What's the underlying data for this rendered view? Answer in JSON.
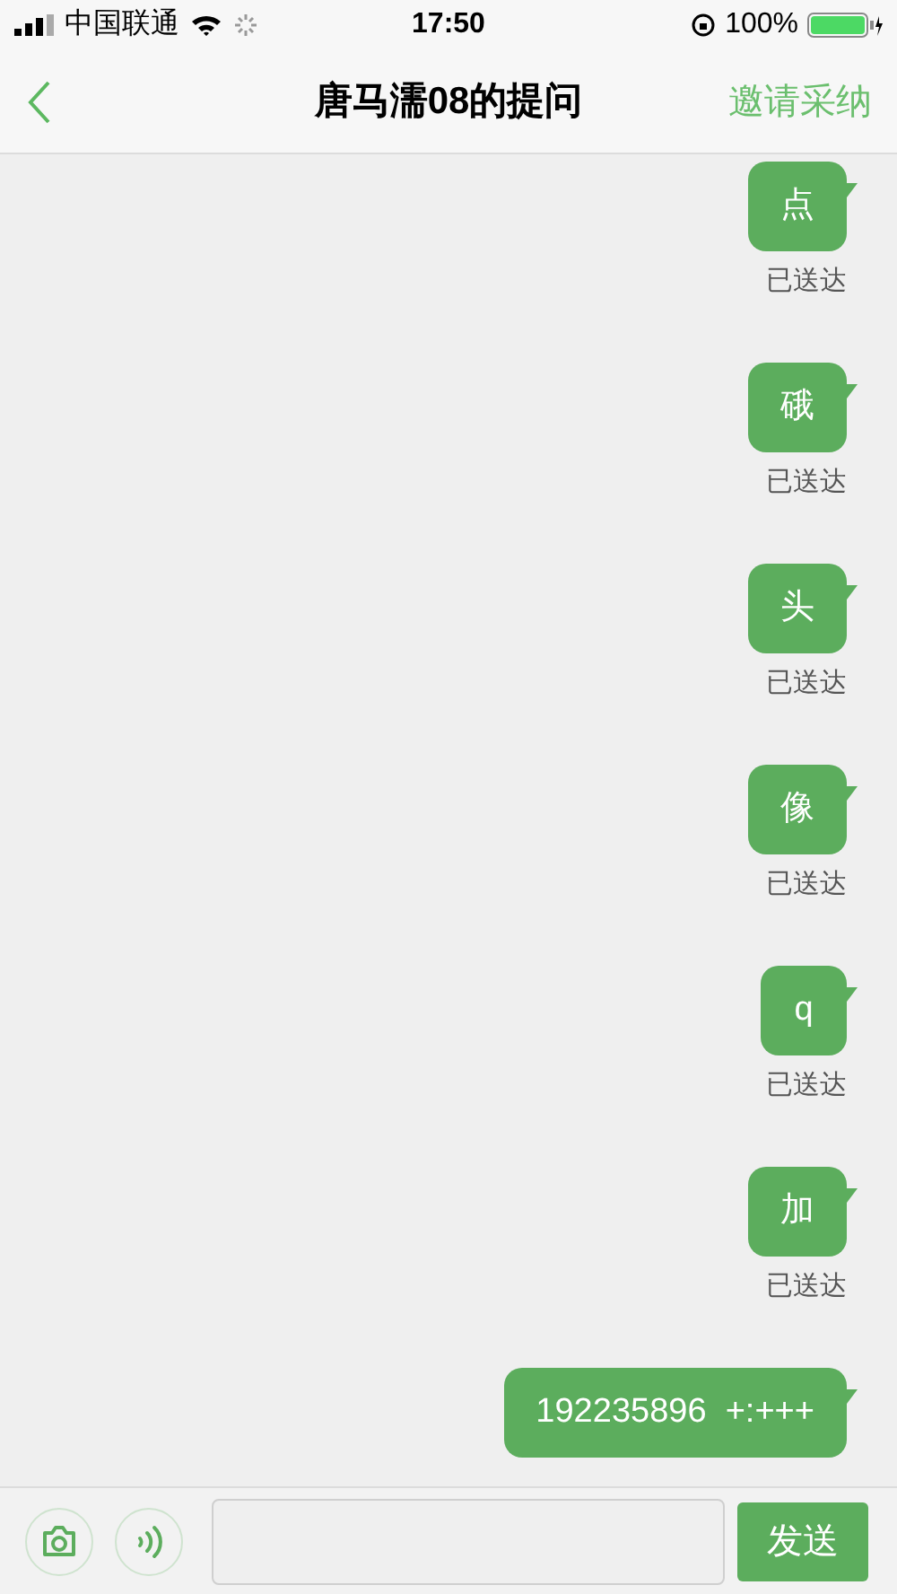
{
  "status_bar": {
    "carrier": "中国联通",
    "time": "17:50",
    "battery": "100%"
  },
  "nav": {
    "title": "唐马濡08的提问",
    "action": "邀请采纳"
  },
  "messages": [
    {
      "text": "点",
      "status": "已送达"
    },
    {
      "text": "硪",
      "status": "已送达"
    },
    {
      "text": "头",
      "status": "已送达"
    },
    {
      "text": "像",
      "status": "已送达"
    },
    {
      "text": "q",
      "status": "已送达"
    },
    {
      "text": "加",
      "status": "已送达"
    },
    {
      "text": "192235896  +:+++"
    }
  ],
  "composer": {
    "send": "发送"
  }
}
